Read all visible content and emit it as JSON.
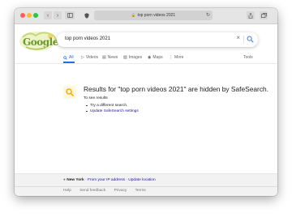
{
  "browser": {
    "url": "top porn videos 2021",
    "back_icon": "chevron-left-icon",
    "forward_icon": "chevron-right-icon",
    "sidebar_icon": "sidebar-icon",
    "shield_icon": "shield-icon",
    "share_icon": "share-icon",
    "tabs_icon": "tabs-icon"
  },
  "search": {
    "query": "top porn videos 2021",
    "clear_icon": "close-icon",
    "search_icon": "search-icon"
  },
  "logo": {
    "text": "Google"
  },
  "tabs": [
    {
      "label": "All",
      "icon": "search-icon",
      "active": true
    },
    {
      "label": "Videos",
      "icon": "video-icon"
    },
    {
      "label": "News",
      "icon": "news-icon"
    },
    {
      "label": "Images",
      "icon": "image-icon"
    },
    {
      "label": "Maps",
      "icon": "map-pin-icon"
    },
    {
      "label": "More",
      "icon": "more-icon"
    }
  ],
  "tools_label": "Tools",
  "notice": {
    "title": "Results for \"top porn videos 2021\" are hidden by SafeSearch.",
    "subtitle": "To see results",
    "items": [
      "Try a different search.",
      "Update SafeSearch settings"
    ]
  },
  "footer": {
    "city": "New York",
    "sep1": " - ",
    "ip_link": "From your IP address",
    "sep2": " - ",
    "update_link": "Update location",
    "links": [
      "Help",
      "Send feedback",
      "Privacy",
      "Terms"
    ]
  },
  "colors": {
    "accent": "#1a73e8",
    "link": "#1a0dab",
    "notice_bg": "#fef7e0",
    "notice_icon": "#f9ab00"
  }
}
